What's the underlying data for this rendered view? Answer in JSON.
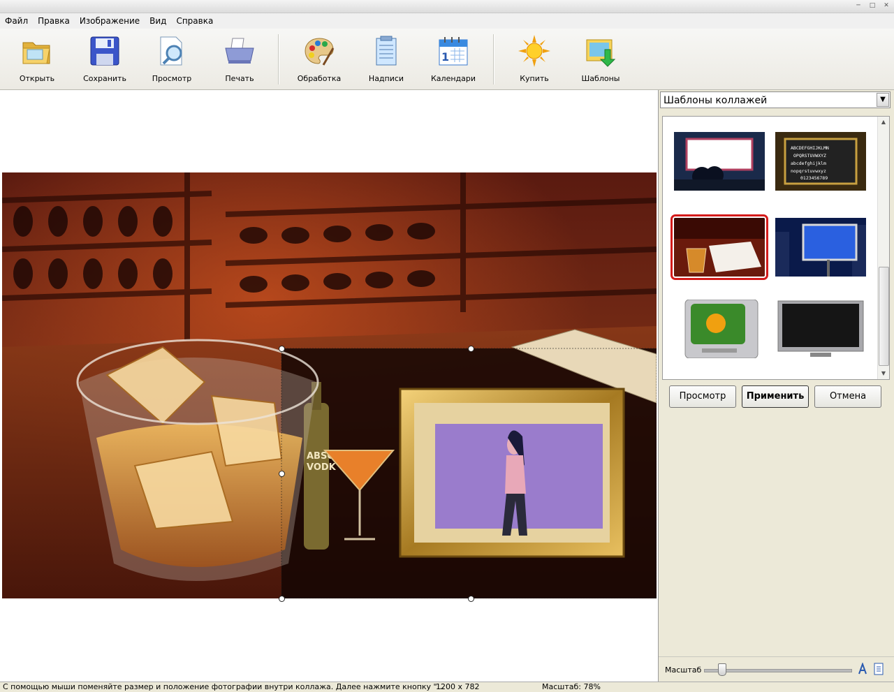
{
  "menu": [
    "Файл",
    "Правка",
    "Изображение",
    "Вид",
    "Справка"
  ],
  "toolbar": {
    "open": "Открыть",
    "save": "Сохранить",
    "preview": "Просмотр",
    "print": "Печать",
    "process": "Обработка",
    "captions": "Надписи",
    "calendars": "Календари",
    "buy": "Купить",
    "templates": "Шаблоны"
  },
  "panel": {
    "dropdown_value": "Шаблоны коллажей",
    "buttons": {
      "preview": "Просмотр",
      "apply": "Применить",
      "cancel": "Отмена"
    },
    "zoom_label": "Масштаб",
    "zoom_slider_fraction": 0.1
  },
  "thumbnails": [
    {
      "name": "cinema-screen",
      "selected": false
    },
    {
      "name": "chalkboard-alphabet",
      "selected": false
    },
    {
      "name": "whiskey-glass-table",
      "selected": true
    },
    {
      "name": "city-billboard",
      "selected": false
    },
    {
      "name": "crt-tv-flower",
      "selected": false
    },
    {
      "name": "flat-tv",
      "selected": false
    }
  ],
  "chalkboard_text": [
    "ABCDEFGHIJKLMN",
    "OPQRSTUVWXYZ",
    "abcdefghijklm",
    "nopqrstuvwxyz",
    "0123456789"
  ],
  "bottle_text": [
    "ABSO",
    "VODK"
  ],
  "status": {
    "hint": "С помощью мыши поменяйте размер и положение фотографии внутри коллажа. Далее нажмите кнопку \"...",
    "size": "1200 x 782",
    "zoom": "Масштаб: 78%"
  },
  "colors": {
    "selection": "#d41a1a",
    "photo_bg": "#9a7ccc"
  }
}
